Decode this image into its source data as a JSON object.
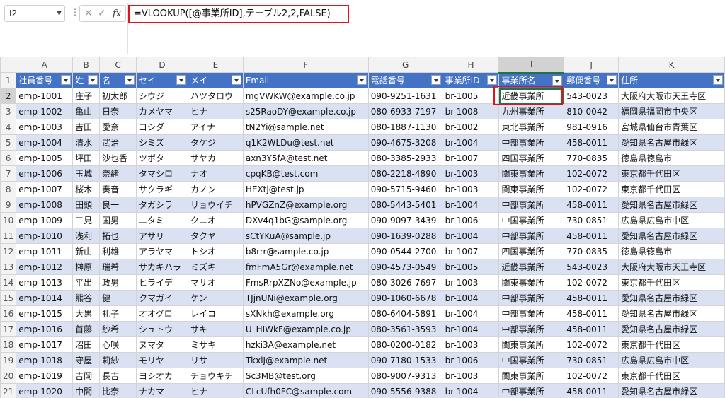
{
  "formula_bar": {
    "name_box": "I2",
    "formula": "=VLOOKUP([@事業所ID],テーブル2,2,FALSE)",
    "fx_label": "fx"
  },
  "columns": [
    "A",
    "B",
    "C",
    "D",
    "E",
    "F",
    "G",
    "H",
    "I",
    "J",
    "K"
  ],
  "active_column": "I",
  "active_row": 2,
  "table": {
    "headers": [
      "社員番号",
      "姓",
      "名",
      "セイ",
      "メイ",
      "Email",
      "電話番号",
      "事業所ID",
      "事業所名",
      "郵便番号",
      "住所"
    ],
    "rows": [
      [
        "emp-1001",
        "庄子",
        "初太郎",
        "シウジ",
        "ハツタロウ",
        "mgVWKW@example.co.jp",
        "090-9251-1631",
        "br-1005",
        "近畿事業所",
        "543-0023",
        "大阪府大阪市天王寺区"
      ],
      [
        "emp-1002",
        "亀山",
        "日奈",
        "カメヤマ",
        "ヒナ",
        "s25RaoDY@example.co.jp",
        "080-6933-7197",
        "br-1008",
        "九州事業所",
        "810-0042",
        "福岡県福岡市中央区"
      ],
      [
        "emp-1003",
        "吉田",
        "愛奈",
        "ヨシダ",
        "アイナ",
        "tN2Yi@sample.net",
        "080-1887-1130",
        "br-1002",
        "東北事業所",
        "981-0916",
        "宮城県仙台市青葉区"
      ],
      [
        "emp-1004",
        "清水",
        "武治",
        "シミズ",
        "タケジ",
        "q1K2WLDu@test.net",
        "090-4675-3208",
        "br-1004",
        "中部事業所",
        "458-0011",
        "愛知県名古屋市緑区"
      ],
      [
        "emp-1005",
        "坪田",
        "沙也香",
        "ツボタ",
        "サヤカ",
        "axn3Y5fA@test.net",
        "080-3385-2933",
        "br-1007",
        "四国事業所",
        "770-0835",
        "徳島県徳島市"
      ],
      [
        "emp-1006",
        "玉城",
        "奈緒",
        "タマシロ",
        "ナオ",
        "cpqKB@test.com",
        "080-2218-4890",
        "br-1003",
        "関東事業所",
        "102-0072",
        "東京都千代田区"
      ],
      [
        "emp-1007",
        "桜木",
        "奏音",
        "サクラギ",
        "カノン",
        "HEXtj@test.jp",
        "090-5715-9460",
        "br-1003",
        "関東事業所",
        "102-0072",
        "東京都千代田区"
      ],
      [
        "emp-1008",
        "田頭",
        "良一",
        "タガシラ",
        "リョウイチ",
        "hPVGZnZ@example.org",
        "080-5443-5401",
        "br-1004",
        "中部事業所",
        "458-0011",
        "愛知県名古屋市緑区"
      ],
      [
        "emp-1009",
        "二見",
        "国男",
        "ニタミ",
        "クニオ",
        "DXv4q1bG@sample.org",
        "090-9097-3439",
        "br-1006",
        "中国事業所",
        "730-0851",
        "広島県広島市中区"
      ],
      [
        "emp-1010",
        "浅利",
        "拓也",
        "アサリ",
        "タクヤ",
        "sCtYKuA@sample.jp",
        "090-1639-0288",
        "br-1004",
        "中部事業所",
        "458-0011",
        "愛知県名古屋市緑区"
      ],
      [
        "emp-1011",
        "新山",
        "利雄",
        "アラヤマ",
        "トシオ",
        "b8rrr@sample.co.jp",
        "090-0544-2700",
        "br-1007",
        "四国事業所",
        "770-0835",
        "徳島県徳島市"
      ],
      [
        "emp-1012",
        "榊原",
        "瑞希",
        "サカキハラ",
        "ミズキ",
        "fmFmA5Gr@example.net",
        "090-4573-0549",
        "br-1005",
        "近畿事業所",
        "543-0023",
        "大阪府大阪市天王寺区"
      ],
      [
        "emp-1013",
        "平出",
        "政男",
        "ヒライデ",
        "マサオ",
        "FmsRrpXZNo@example.jp",
        "080-3026-7697",
        "br-1003",
        "関東事業所",
        "102-0072",
        "東京都千代田区"
      ],
      [
        "emp-1014",
        "熊谷",
        "健",
        "クマガイ",
        "ケン",
        "TJjnUNi@example.org",
        "090-1060-6678",
        "br-1004",
        "中部事業所",
        "458-0011",
        "愛知県名古屋市緑区"
      ],
      [
        "emp-1015",
        "大黒",
        "礼子",
        "オオグロ",
        "レイコ",
        "sXNkh@example.org",
        "080-6404-5891",
        "br-1004",
        "中部事業所",
        "458-0011",
        "愛知県名古屋市緑区"
      ],
      [
        "emp-1016",
        "首藤",
        "紗希",
        "シュトウ",
        "サキ",
        "U_HIWkF@example.co.jp",
        "080-3561-3593",
        "br-1004",
        "中部事業所",
        "458-0011",
        "愛知県名古屋市緑区"
      ],
      [
        "emp-1017",
        "沼田",
        "心咲",
        "ヌマタ",
        "ミサキ",
        "hzki3A@example.net",
        "080-0200-0182",
        "br-1003",
        "関東事業所",
        "102-0072",
        "東京都千代田区"
      ],
      [
        "emp-1018",
        "守屋",
        "莉紗",
        "モリヤ",
        "リサ",
        "TkxlJ@example.net",
        "090-7180-1533",
        "br-1006",
        "中国事業所",
        "730-0851",
        "広島県広島市中区"
      ],
      [
        "emp-1019",
        "吉岡",
        "長吉",
        "ヨシオカ",
        "チョウキチ",
        "Sc3MB@test.org",
        "080-9007-9313",
        "br-1003",
        "関東事業所",
        "102-0072",
        "東京都千代田区"
      ],
      [
        "emp-1020",
        "中間",
        "比奈",
        "ナカマ",
        "ヒナ",
        "CLcUfh0FC@sample.com",
        "090-5556-9388",
        "br-1004",
        "中部事業所",
        "458-0011",
        "愛知県名古屋市緑区"
      ]
    ]
  },
  "colors": {
    "header_fill": "#4472c4",
    "band_fill": "#d9e1f2",
    "highlight_box": "#e0121b",
    "selection": "#217346"
  }
}
